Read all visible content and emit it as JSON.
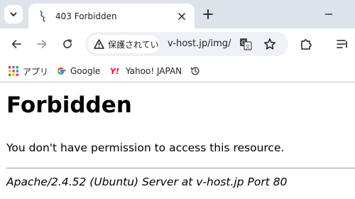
{
  "browser": {
    "tab": {
      "title": "403 Forbidden",
      "favicon": "sync-swirl-icon"
    },
    "colors": {
      "tabstrip": "#dde3ea",
      "omnibox": "#eef1f6",
      "icon": "#444746"
    }
  },
  "toolbar": {
    "security_label": "保護されてい",
    "url": "v-host.jp/img/"
  },
  "bookmarks": {
    "items": [
      {
        "label": "アプリ",
        "icon": "apps-grid-icon"
      },
      {
        "label": "Google",
        "icon": "google-g-icon"
      },
      {
        "label": "Yahoo! JAPAN",
        "icon": "yahoo-y-icon"
      }
    ]
  },
  "page": {
    "heading": "Forbidden",
    "message": "You don't have permission to access this resource.",
    "address": "Apache/2.4.52 (Ubuntu) Server at v-host.jp Port 80"
  }
}
